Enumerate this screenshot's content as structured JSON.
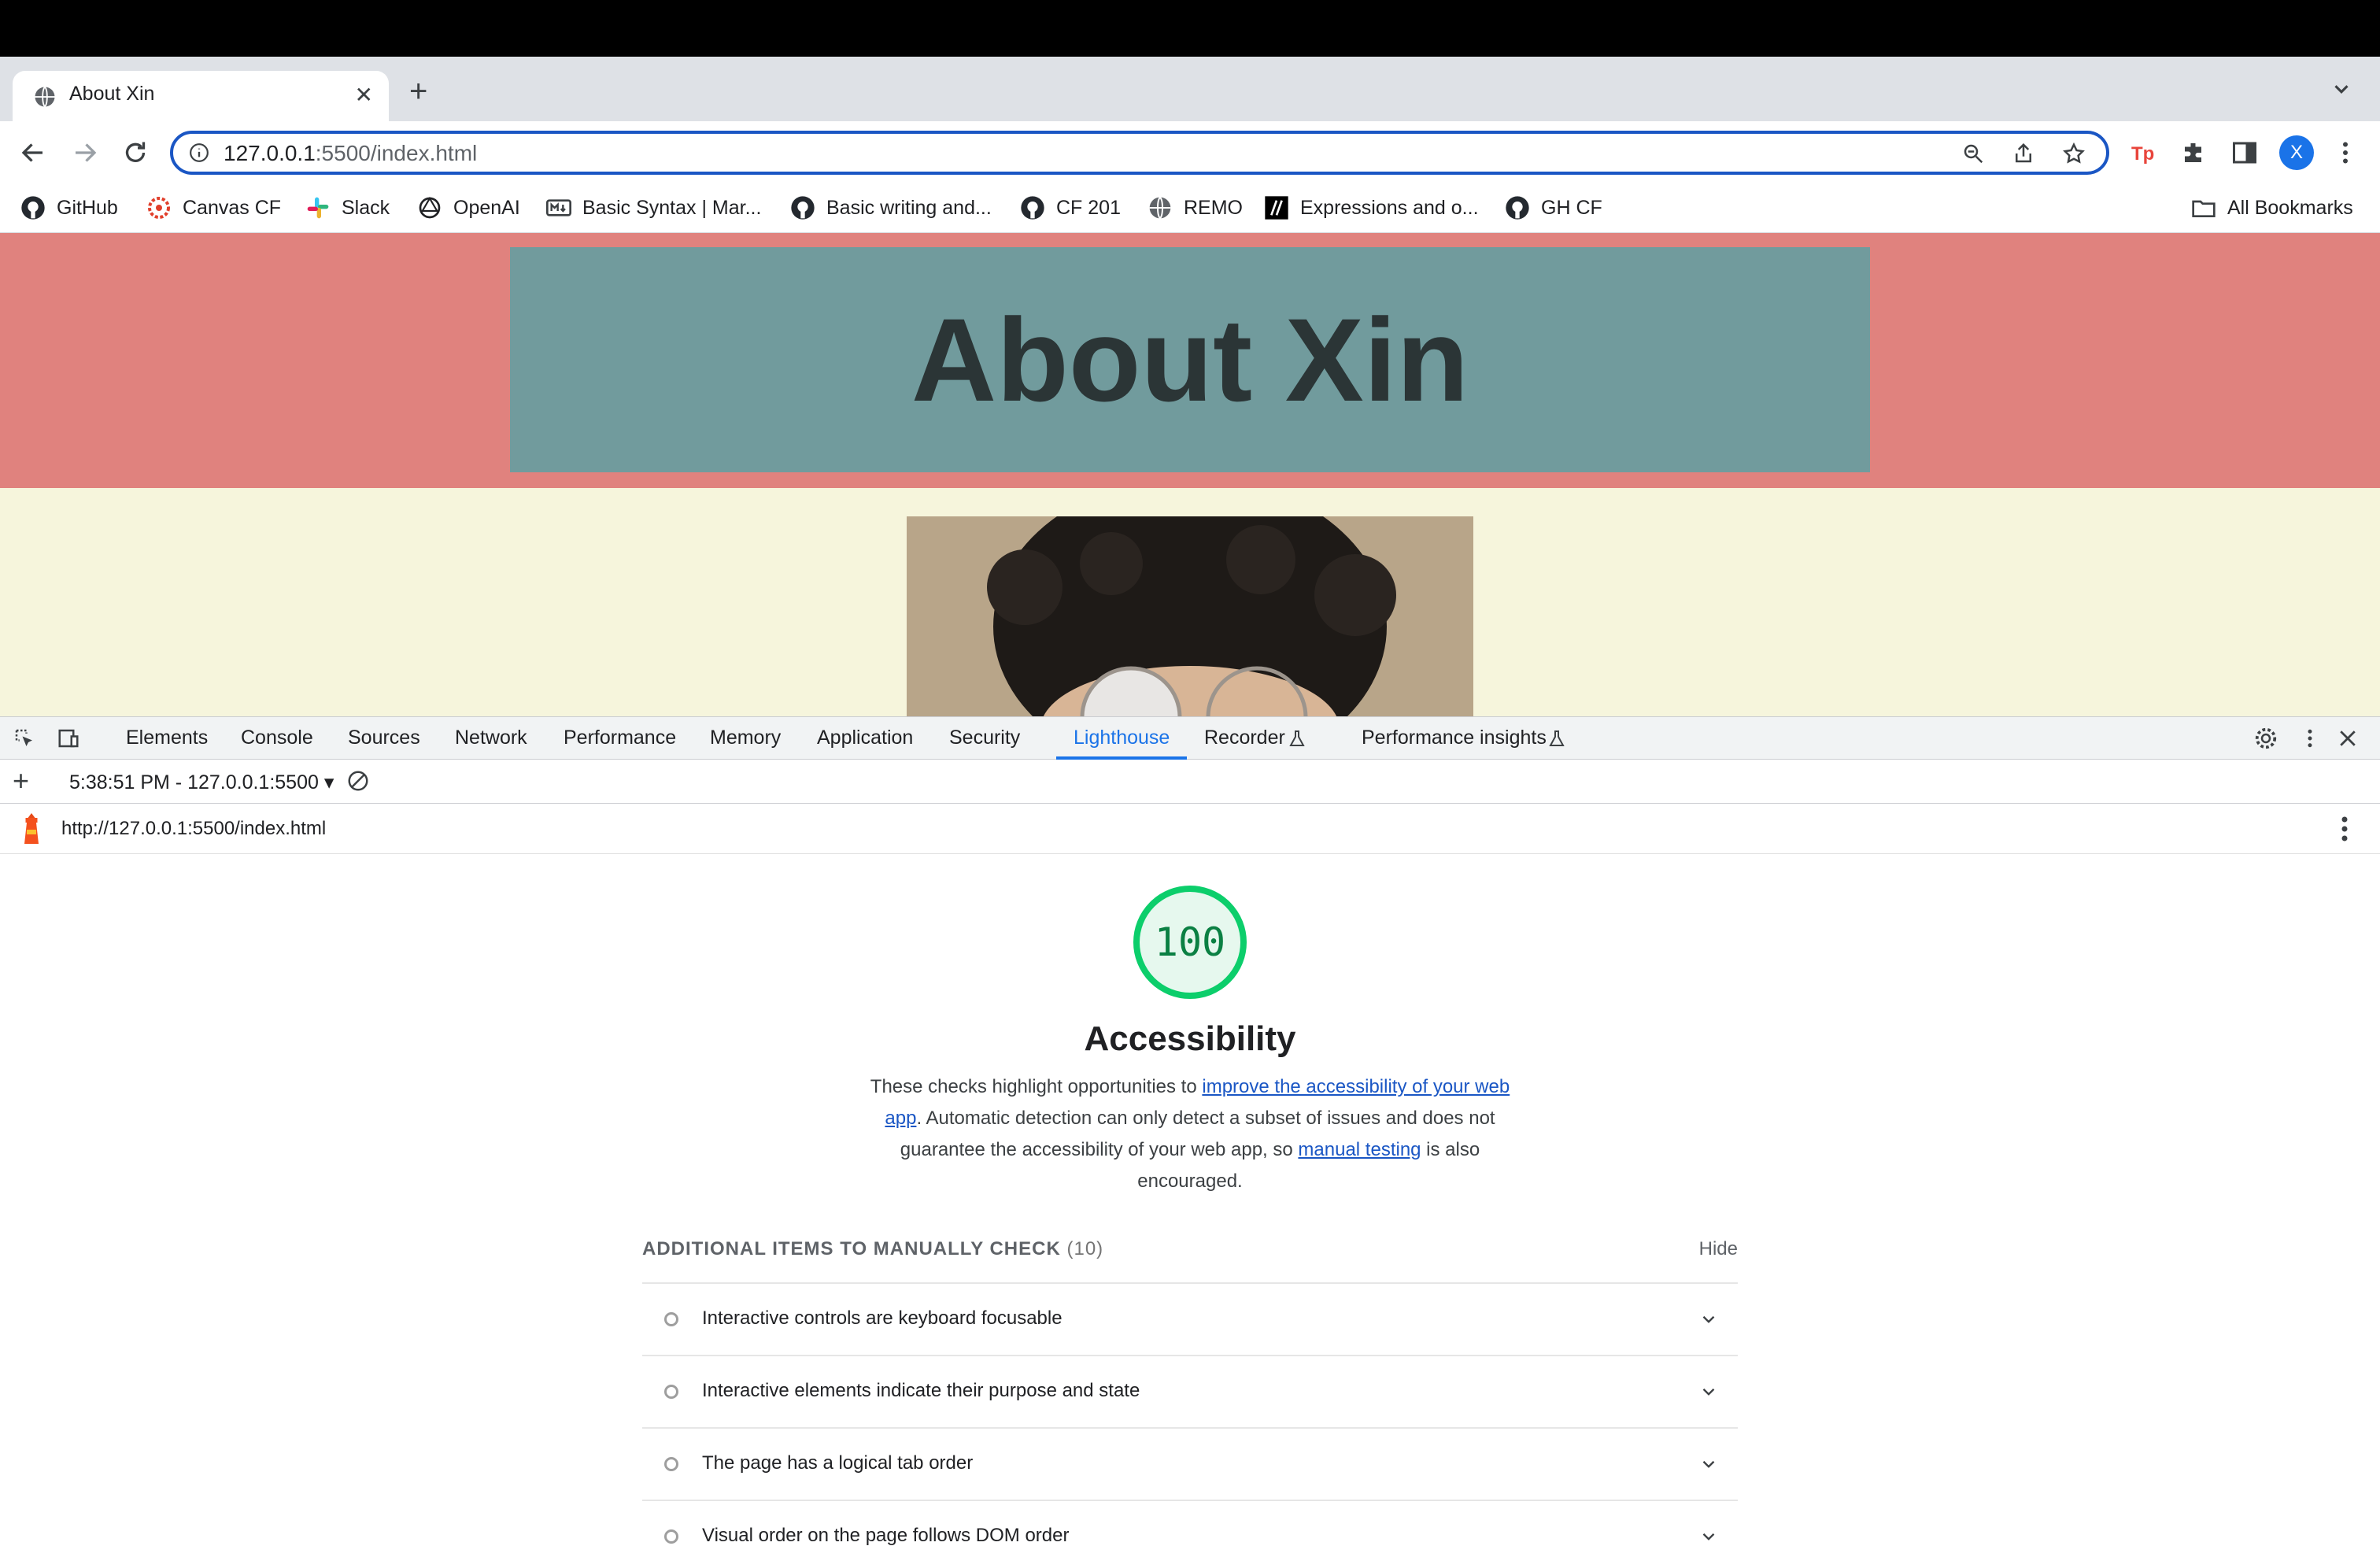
{
  "browser": {
    "tab_title": "About Xin",
    "url_host": "127.0.0.1",
    "url_rest": ":5500/index.html",
    "profile_initial": "X",
    "bookmarks": [
      {
        "label": "GitHub",
        "icon": "github-icon"
      },
      {
        "label": "Canvas CF",
        "icon": "canvas-icon"
      },
      {
        "label": "Slack",
        "icon": "slack-icon"
      },
      {
        "label": "OpenAI",
        "icon": "openai-icon"
      },
      {
        "label": "Basic Syntax | Mar...",
        "icon": "markdown-icon"
      },
      {
        "label": "Basic writing and...",
        "icon": "github-icon"
      },
      {
        "label": "CF 201",
        "icon": "github-icon"
      },
      {
        "label": "REMO",
        "icon": "globe-icon"
      },
      {
        "label": "Expressions and o...",
        "icon": "mdn-icon"
      },
      {
        "label": "GH CF",
        "icon": "github-icon"
      }
    ],
    "all_bookmarks": "All Bookmarks"
  },
  "page": {
    "hero_title": "About Xin",
    "colors": {
      "hero_bg": "#e0827e",
      "hero_box": "#719b9d",
      "body_bg": "#f6f5dc"
    }
  },
  "devtools": {
    "tabs": [
      "Elements",
      "Console",
      "Sources",
      "Network",
      "Performance",
      "Memory",
      "Application",
      "Security",
      "Lighthouse",
      "Recorder",
      "Performance insights"
    ],
    "active_tab": "Lighthouse",
    "report_select": "5:38:51 PM - 127.0.0.1:5500",
    "report_url": "http://127.0.0.1:5500/index.html",
    "score": "100",
    "category_title": "Accessibility",
    "desc": {
      "part1": "These checks highlight opportunities to ",
      "link1": "improve the accessibility of your web app",
      "part2": ". Automatic detection can only detect a subset of issues and does not guarantee the accessibility of your web app, so ",
      "link2": "manual testing",
      "part3": " is also encouraged."
    },
    "manual_label": "ADDITIONAL ITEMS TO MANUALLY CHECK",
    "manual_count": "(10)",
    "hide_label": "Hide",
    "audits": [
      "Interactive controls are keyboard focusable",
      "Interactive elements indicate their purpose and state",
      "The page has a logical tab order",
      "Visual order on the page follows DOM order"
    ]
  }
}
